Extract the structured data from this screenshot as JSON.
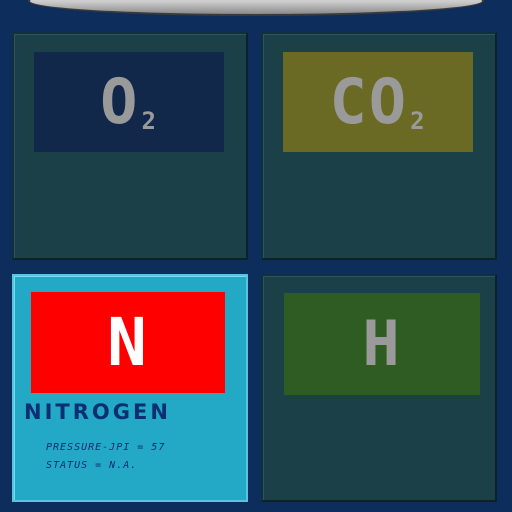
{
  "tiles": [
    {
      "id": "o2",
      "symbol": "O",
      "subscript": "2",
      "color": "#11284a"
    },
    {
      "id": "co2",
      "symbol": "CO",
      "subscript": "2",
      "color": "#6b6a24"
    },
    {
      "id": "n",
      "symbol": "N",
      "color": "#ff0000",
      "selected": true,
      "name": "NITROGEN",
      "pressure_text": "PRESSURE-JPI = 57",
      "status_text": "STATUS = N.A."
    },
    {
      "id": "h",
      "symbol": "H",
      "color": "#2f5c22"
    }
  ],
  "colors": {
    "background": "#0d2e5c",
    "tile": "#1c4048",
    "tile_active": "#23a9c6"
  }
}
